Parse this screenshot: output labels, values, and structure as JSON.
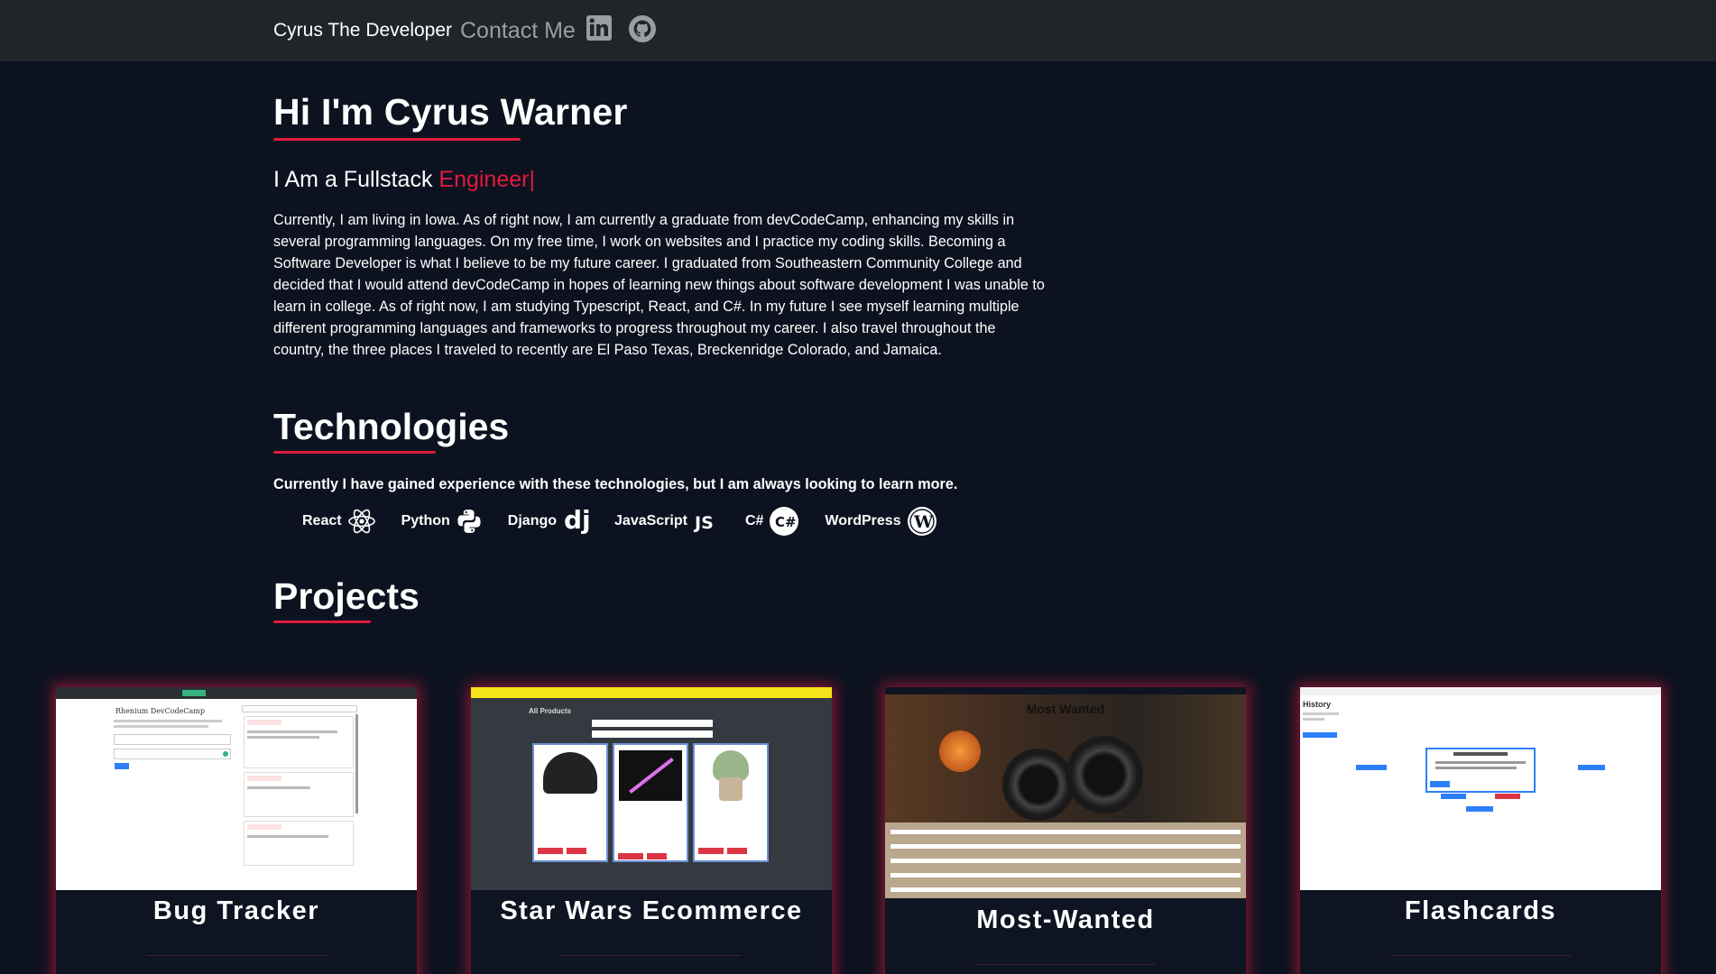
{
  "nav": {
    "brand": "Cyrus The Developer",
    "contact": "Contact Me",
    "linkedin_icon": "linkedin-icon",
    "github_icon": "github-icon"
  },
  "hero": {
    "title": "Hi I'm Cyrus Warner",
    "subtitle_prefix": "I Am a Fullstack ",
    "subtitle_accent": "Engineer",
    "cursor": "|",
    "bio": "Currently, I am living in Iowa. As of right now, I am currently a graduate from devCodeCamp, enhancing my skills in several programming languages. On my free time, I work on websites and I practice my coding skills. Becoming a Software Developer is what I believe to be my future career. I graduated from Southeastern Community College and decided that I would attend devCodeCamp in hopes of learning new things about software development I was unable to learn in college. As of right now, I am studying Typescript, React, and C#. In my future I see myself learning multiple different programming languages and frameworks to progress throughout my career. I also travel throughout the country, the three places I traveled to recently are El Paso Texas, Breckenridge Colorado, and Jamaica."
  },
  "technologies": {
    "title": "Technologies",
    "note": "Currently I have gained experience with these technologies, but I am always looking to learn more.",
    "items": [
      {
        "label": "React",
        "icon": "react-icon"
      },
      {
        "label": "Python",
        "icon": "python-icon"
      },
      {
        "label": "Django",
        "icon": "django-icon"
      },
      {
        "label": "JavaScript",
        "icon": "javascript-icon"
      },
      {
        "label": "C#",
        "icon": "csharp-icon"
      },
      {
        "label": "WordPress",
        "icon": "wordpress-icon"
      }
    ]
  },
  "projects": {
    "title": "Projects",
    "items": [
      {
        "title": "Bug Tracker",
        "thumb_heading": "Rhenium DevCodeCamp"
      },
      {
        "title": "Star Wars Ecommerce",
        "thumb_heading": "All Products"
      },
      {
        "title": "Most-Wanted",
        "thumb_heading": "Most Wanted"
      },
      {
        "title": "Flashcards",
        "thumb_heading": "History"
      }
    ]
  },
  "colors": {
    "background": "#0d1220",
    "navbar": "#212529",
    "accent": "#e01a3c",
    "muted": "#9a9da1"
  }
}
